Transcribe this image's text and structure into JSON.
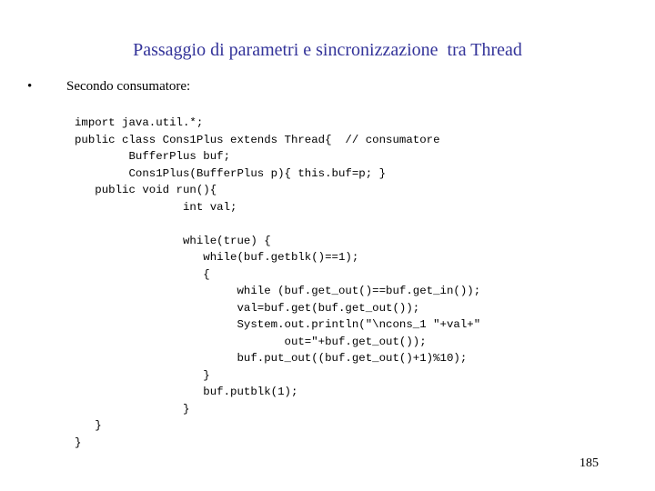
{
  "slide": {
    "title": "Passaggio di parametri e sincronizzazione  tra Thread",
    "bullet_symbol": "•",
    "bullet_text": "Secondo consumatore:",
    "code_lines": [
      "import java.util.*;",
      "public class Cons1Plus extends Thread{  // consumatore",
      "        BufferPlus buf;",
      "        Cons1Plus(BufferPlus p){ this.buf=p; }",
      "   public void run(){",
      "                int val;",
      "",
      "                while(true) {",
      "                   while(buf.getblk()==1);",
      "                   {",
      "                        while (buf.get_out()==buf.get_in());",
      "                        val=buf.get(buf.get_out());",
      "                        System.out.println(\"\\ncons_1 \"+val+\"",
      "                               out=\"+buf.get_out());",
      "                        buf.put_out((buf.get_out()+1)%10);",
      "                   }",
      "                   buf.putblk(1);",
      "                }",
      "   }",
      "}"
    ],
    "page_number": "185"
  }
}
